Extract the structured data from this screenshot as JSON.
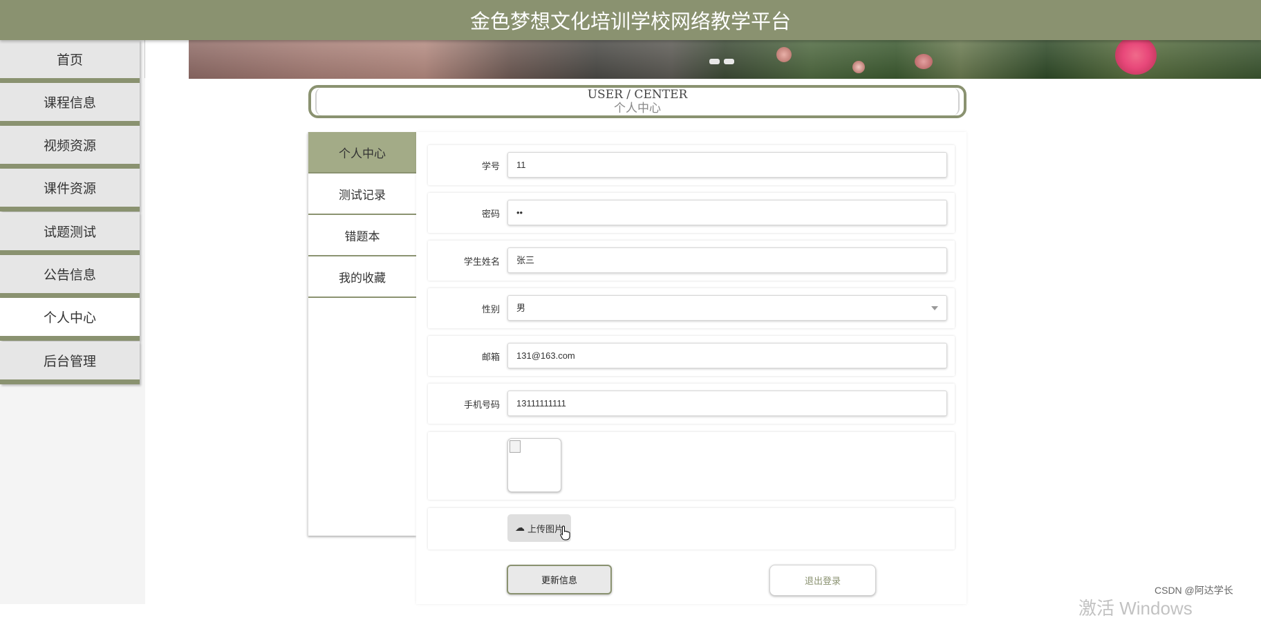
{
  "header": {
    "title": "金色梦想文化培训学校网络教学平台"
  },
  "nav": {
    "items": [
      {
        "label": "首页"
      },
      {
        "label": "课程信息"
      },
      {
        "label": "视频资源"
      },
      {
        "label": "课件资源"
      },
      {
        "label": "试题测试"
      },
      {
        "label": "公告信息"
      },
      {
        "label": "个人中心",
        "active": true
      },
      {
        "label": "后台管理"
      }
    ]
  },
  "user_center": {
    "title_en": "USER / CENTER",
    "title_cn": "个人中心"
  },
  "side_tabs": [
    {
      "label": "个人中心",
      "active": true
    },
    {
      "label": "测试记录"
    },
    {
      "label": "错题本"
    },
    {
      "label": "我的收藏"
    }
  ],
  "form": {
    "student_id": {
      "label": "学号",
      "value": "11"
    },
    "password": {
      "label": "密码",
      "value": "••"
    },
    "student_name": {
      "label": "学生姓名",
      "value": "张三"
    },
    "gender": {
      "label": "性别",
      "value": "男"
    },
    "email": {
      "label": "邮箱",
      "value": "131@163.com"
    },
    "phone": {
      "label": "手机号码",
      "value": "13111111111"
    },
    "upload_label": "上传图片"
  },
  "actions": {
    "update": "更新信息",
    "logout": "退出登录"
  },
  "watermark": "CSDN @阿达学长",
  "os_overlay": "激活 Windows",
  "colors": {
    "accent": "#8a9270",
    "active_tab": "#a3ab87"
  }
}
